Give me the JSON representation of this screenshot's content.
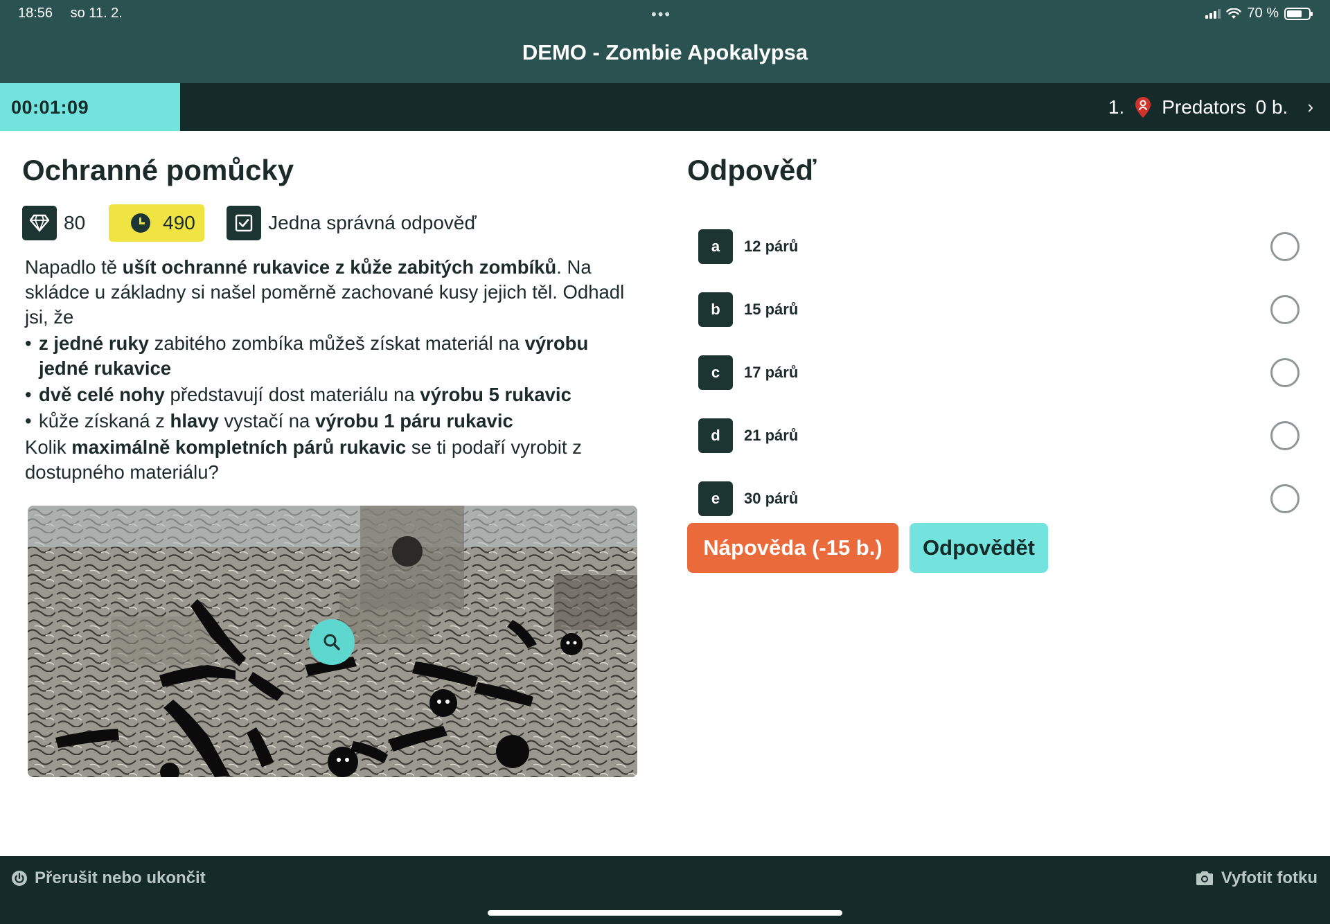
{
  "status_bar": {
    "time": "18:56",
    "date": "so 11. 2.",
    "battery": "70 %"
  },
  "app": {
    "title": "DEMO - Zombie Apokalypsa"
  },
  "timer": {
    "value": "00:01:09"
  },
  "team": {
    "rank": "1.",
    "name": "Predators",
    "score": "0 b."
  },
  "question": {
    "title": "Ochranné pomůcky",
    "points": "80",
    "time": "490",
    "mode": "Jedna správná odpověď",
    "text": {
      "p1_a": "Napadlo tě ",
      "p1_b": "ušít ochranné rukavice z kůže zabitých zombíků",
      "p1_c": ". Na skládce u základny si našel poměrně zachované kusy jejich těl. Odhadl jsi, že",
      "b1_a": "z jedné ruky",
      "b1_b": " zabitého zombíka můžeš získat materiál na ",
      "b1_c": "výrobu jedné rukavice",
      "b2_a": "dvě celé nohy",
      "b2_b": " představují dost materiálu na ",
      "b2_c": "výrobu 5 rukavic",
      "b3_a": "kůže získaná z ",
      "b3_b": "hlavy",
      "b3_c": " vystačí na ",
      "b3_d": "výrobu 1 páru rukavic",
      "p2_a": "Kolik ",
      "p2_b": "maximálně kompletních párů rukavic",
      "p2_c": " se ti podaří vyrobit z dostupného materiálu?"
    }
  },
  "answer_panel": {
    "title": "Odpověď",
    "options": [
      {
        "letter": "a",
        "label": "12 párů"
      },
      {
        "letter": "b",
        "label": "15 párů"
      },
      {
        "letter": "c",
        "label": "17 párů"
      },
      {
        "letter": "d",
        "label": "21 párů"
      },
      {
        "letter": "e",
        "label": "30 párů"
      }
    ],
    "hint_button": "Nápověda (-15 b.)",
    "submit_button": "Odpovědět"
  },
  "bottom_bar": {
    "quit": "Přerušit nebo ukončit",
    "photo": "Vyfotit fotku"
  },
  "colors": {
    "header": "#2a5250",
    "dark": "#142b29",
    "accent": "#73e3de",
    "hint": "#ea6a3b",
    "time_badge": "#f0e442"
  }
}
